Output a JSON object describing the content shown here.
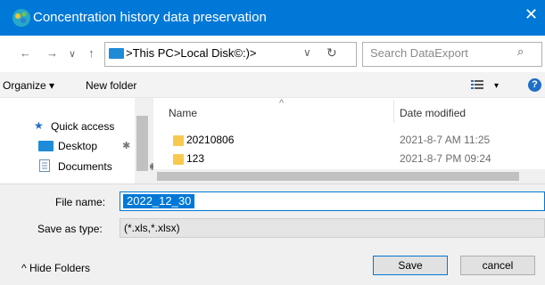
{
  "window": {
    "title": "Concentration history data preservation",
    "close_glyph": "✕",
    "icon": "app-logo-icon"
  },
  "nav": {
    "back": "←",
    "forward": "→",
    "recent": "∨",
    "up": "↑",
    "refresh": "↻"
  },
  "address": {
    "path": ">This PC>Local Disk©:)>",
    "chevron": "∨"
  },
  "search": {
    "placeholder": "Search DataExport",
    "icon": "⌕"
  },
  "toolbar": {
    "organize": "Organize ▾",
    "new_folder": "New folder",
    "view_dropdown": "▾",
    "help": "?"
  },
  "sidebar": {
    "items": [
      {
        "label": "Quick access",
        "icon": "star-icon"
      },
      {
        "label": "Desktop",
        "icon": "desktop-icon",
        "pin": "✱"
      },
      {
        "label": "Documents",
        "icon": "documents-icon",
        "pin": "✱"
      }
    ]
  },
  "filelist": {
    "columns": {
      "name": "Name",
      "date": "Date modified",
      "sort_indicator": "^"
    },
    "rows": [
      {
        "name": "20210806",
        "date": "2021-8-7 AM 11:25"
      },
      {
        "name": "123",
        "date": "2021-8-7 PM 09:24"
      }
    ]
  },
  "form": {
    "file_name_label": "File name:",
    "file_name_value": "2022_12_30",
    "save_type_label": "Save as type:",
    "save_type_value": "(*.xls,*.xlsx)"
  },
  "footer": {
    "hide_folders": "^ Hide Folders",
    "save": "Save",
    "cancel": "cancel"
  },
  "colors": {
    "accent": "#0078d7",
    "folder": "#f7c94f",
    "help": "#1e6fc8"
  }
}
